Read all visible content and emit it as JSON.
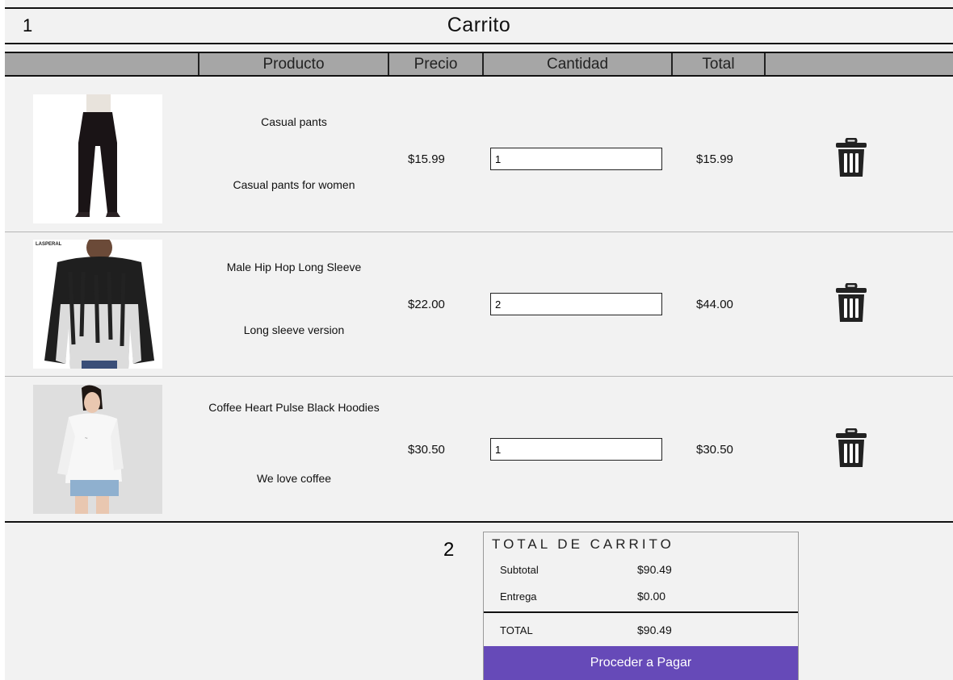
{
  "section1_number": "1",
  "section2_number": "2",
  "cart": {
    "title": "Carrito",
    "columns": [
      "Producto",
      "Precio",
      "Cantidad",
      "Total"
    ],
    "items": [
      {
        "name": "Casual pants",
        "description": "Casual pants for women",
        "price": "$15.99",
        "quantity": "1",
        "total": "$15.99"
      },
      {
        "name": "Male Hip Hop Long Sleeve",
        "description": "Long sleeve version",
        "price": "$22.00",
        "quantity": "2",
        "total": "$44.00",
        "brand_label": "LASPERAL"
      },
      {
        "name": "Coffee Heart Pulse Black Hoodies",
        "description": "We love coffee",
        "price": "$30.50",
        "quantity": "1",
        "total": "$30.50"
      }
    ],
    "delete_icon": "trash-icon"
  },
  "totals": {
    "title": "TOTAL DE CARRITO",
    "subtotal_label": "Subtotal",
    "subtotal_value": "$90.49",
    "delivery_label": "Entrega",
    "delivery_value": "$0.00",
    "total_label": "TOTAL",
    "total_value": "$90.49",
    "checkout_label": "Proceder a Pagar"
  },
  "colors": {
    "background": "#f2f2f2",
    "header_bar": "#a6a6a6",
    "checkout_button": "#664ab8"
  }
}
